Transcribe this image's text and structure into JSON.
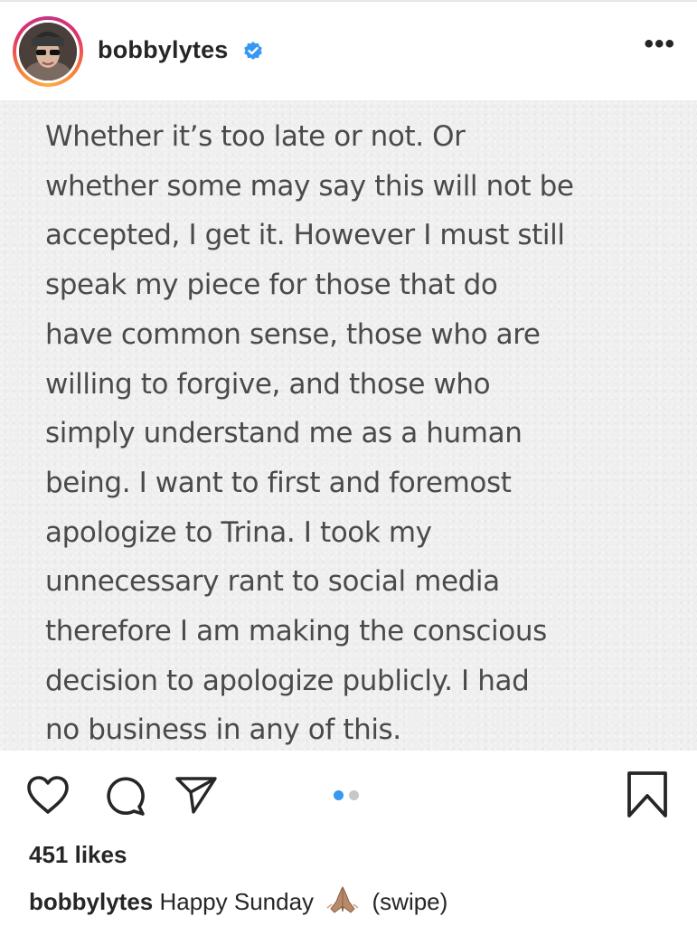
{
  "post": {
    "username": "bobbylytes",
    "verified": true,
    "more_label": "•••",
    "image_text_lines": [
      "Whether it’s too late or not. Or",
      "whether some may say this will not be",
      "accepted, I get it. However I must still",
      "speak my piece for those that do",
      "have common sense, those who are",
      "willing to forgive, and those who",
      "simply understand me as a human",
      "being. I want to first and foremost",
      "apologize to Trina. I took my",
      "unnecessary rant to social media",
      "therefore I am making the conscious",
      "decision to apologize publicly. I had",
      "no business in any of this."
    ],
    "carousel": {
      "total": 2,
      "current": 1
    },
    "likes": "451 likes",
    "caption": {
      "username": "bobbylytes",
      "text_before": "Happy Sunday",
      "emoji": "folded-hands-emoji",
      "text_after": "(swipe)"
    }
  },
  "colors": {
    "accent": "#3897f0",
    "verified_badge": "#3897f0",
    "text": "#262626",
    "image_text": "#4a4a4a",
    "image_bg": "#efefef"
  },
  "icons": {
    "like": "heart-icon",
    "comment": "comment-icon",
    "share": "paper-plane-icon",
    "save": "bookmark-icon",
    "more": "more-options-icon",
    "verified": "verified-badge-icon"
  }
}
